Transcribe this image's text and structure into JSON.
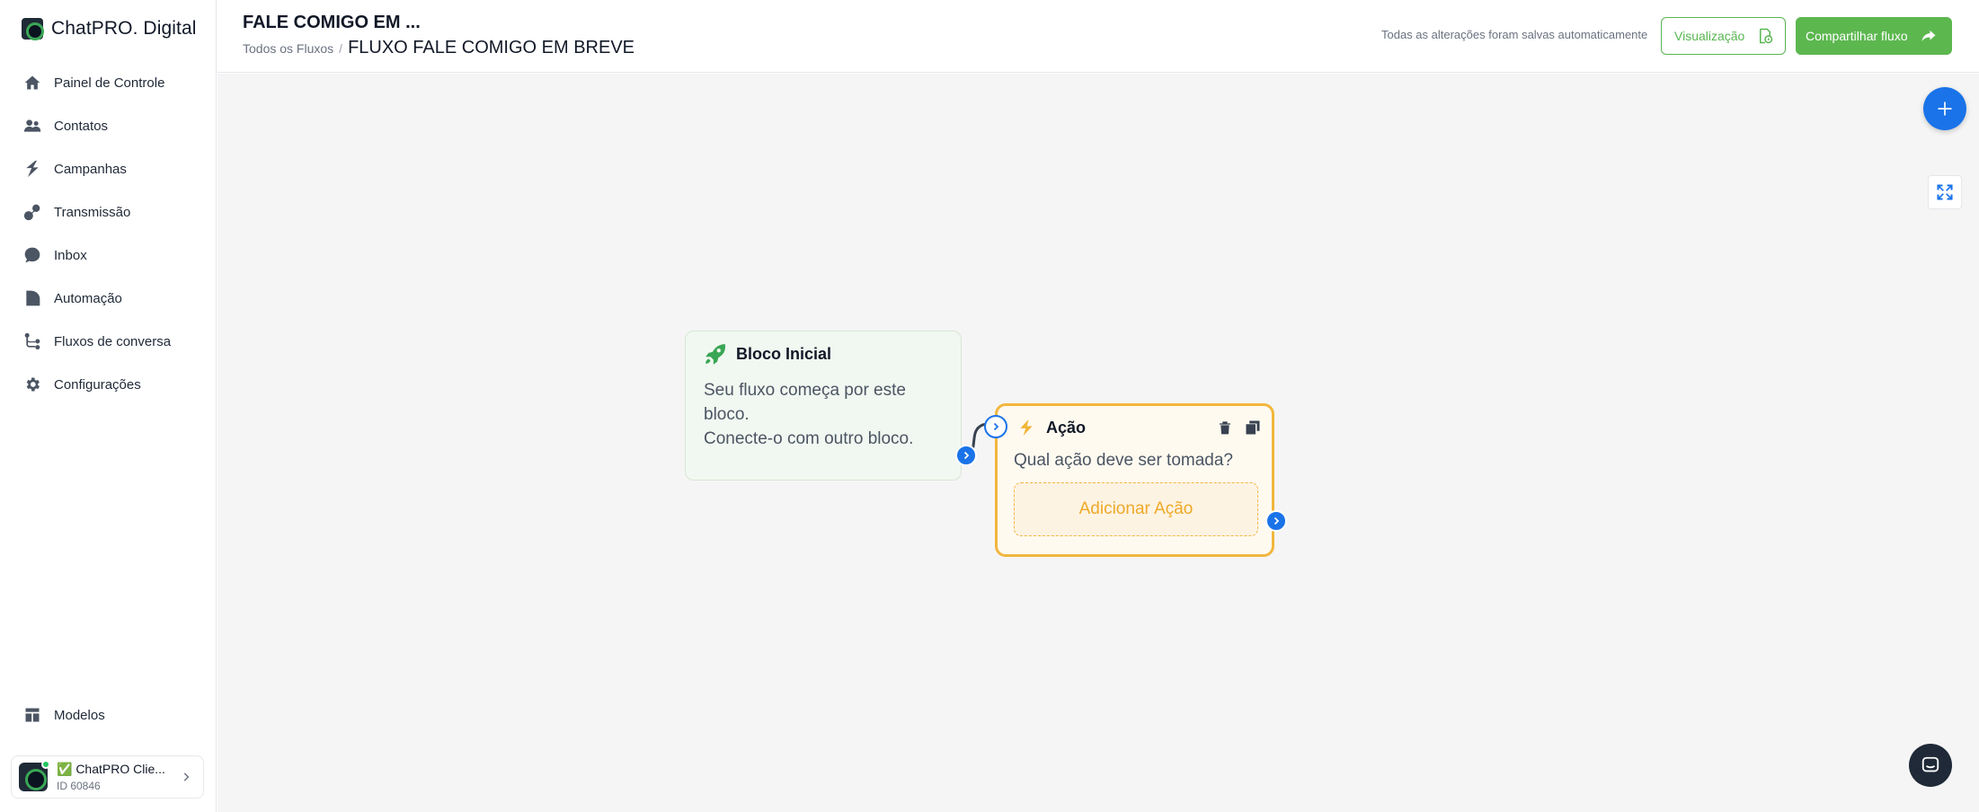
{
  "brand": {
    "name": "ChatPRO. Digital"
  },
  "sidebar": {
    "items": [
      {
        "label": "Painel de Controle",
        "icon": "home-icon"
      },
      {
        "label": "Contatos",
        "icon": "users-icon"
      },
      {
        "label": "Campanhas",
        "icon": "bolt-icon"
      },
      {
        "label": "Transmissão",
        "icon": "broadcast-icon"
      },
      {
        "label": "Inbox",
        "icon": "chat-bubble-icon"
      },
      {
        "label": "Automação",
        "icon": "automation-icon"
      },
      {
        "label": "Fluxos de conversa",
        "icon": "flow-icon"
      },
      {
        "label": "Configurações",
        "icon": "gear-icon"
      }
    ],
    "bottom_items": [
      {
        "label": "Modelos",
        "icon": "templates-icon"
      }
    ],
    "account": {
      "name": "✅ ChatPRO Clie...",
      "id": "ID 60846"
    }
  },
  "header": {
    "title": "FALE COMIGO EM ...",
    "breadcrumb_root": "Todos os Fluxos",
    "breadcrumb_sep": "/",
    "breadcrumb_current": "FLUXO FALE COMIGO EM BREVE",
    "autosave": "Todas as alterações foram salvas automaticamente",
    "preview_label": "Visualização",
    "share_label": "Compartilhar fluxo"
  },
  "canvas": {
    "start_block": {
      "title": "Bloco Inicial",
      "line1": "Seu fluxo começa por este bloco.",
      "line2": "Conecte-o com outro bloco."
    },
    "action_block": {
      "title": "Ação",
      "question": "Qual ação deve ser tomada?",
      "add_label": "Adicionar Ação"
    }
  },
  "colors": {
    "accent": "#1a73e8",
    "brand_green": "#5cb74f",
    "action_border": "#f2b63c",
    "start_bg": "#f1f8f1"
  }
}
